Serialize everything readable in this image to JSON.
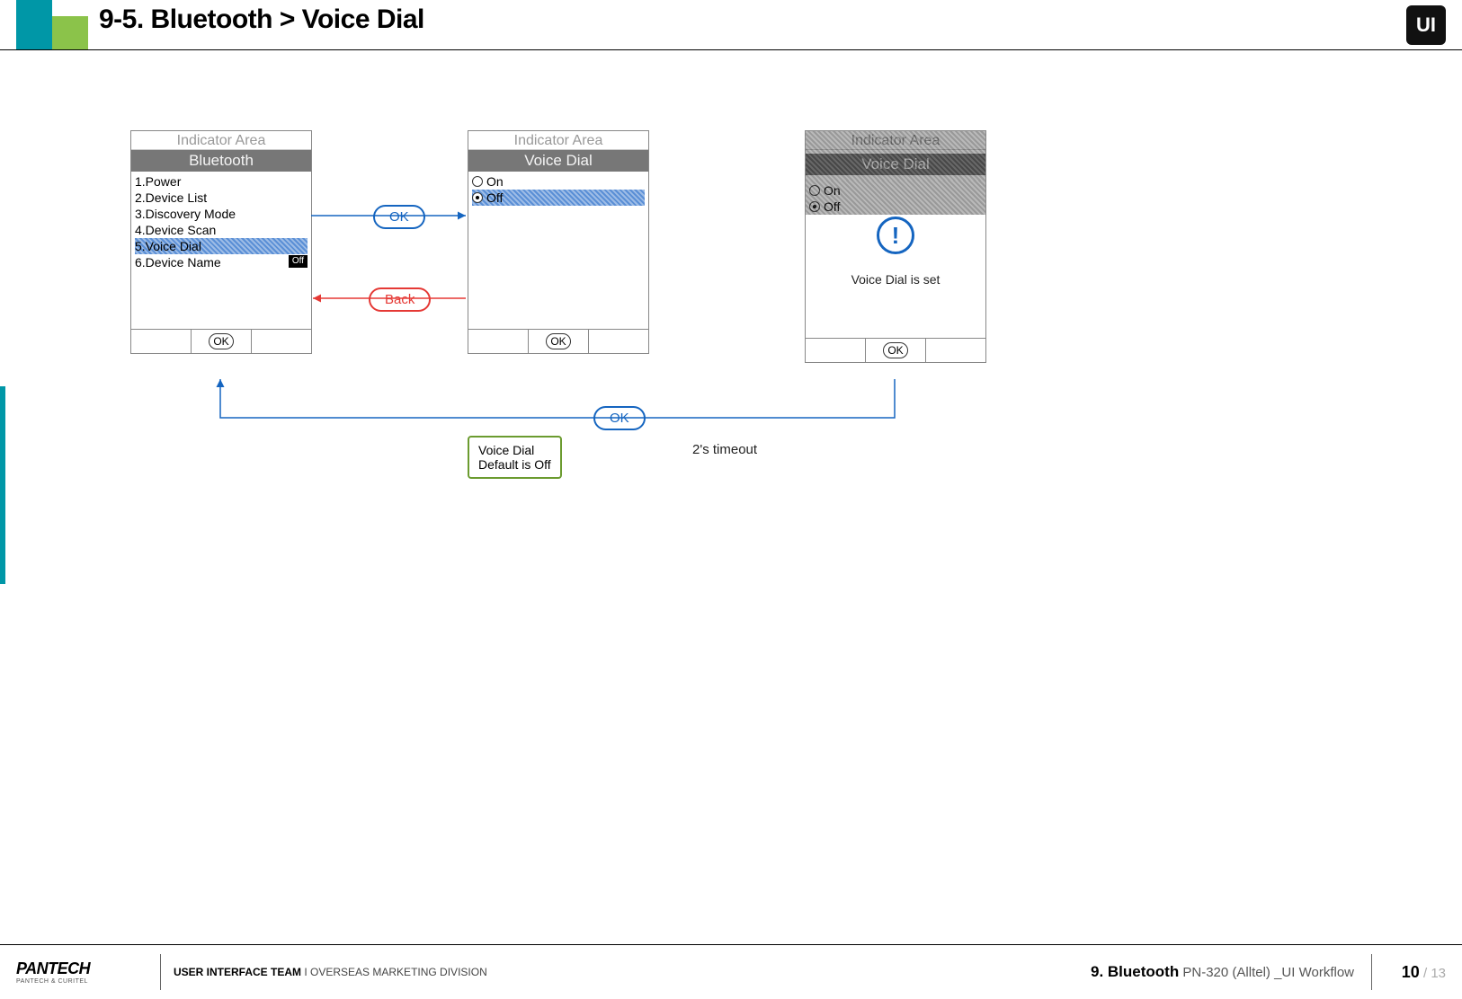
{
  "header": {
    "title": "9-5. Bluetooth > Voice Dial",
    "logo": "UI"
  },
  "phone1": {
    "indicator": "Indicator Area",
    "title": "Bluetooth",
    "items": [
      "1.Power",
      "2.Device List",
      "3.Discovery Mode",
      "4.Device Scan",
      "5.Voice Dial",
      "6.Device Name"
    ],
    "selected_index": 4,
    "badge_on_index": 5,
    "badge_text": "Off",
    "softkey_center": "OK"
  },
  "phone2": {
    "indicator": "Indicator Area",
    "title": "Voice Dial",
    "options": [
      "On",
      "Off"
    ],
    "selected_index": 1,
    "softkey_center": "OK"
  },
  "phone3": {
    "indicator": "Indicator Area",
    "title": "Voice Dial",
    "bg_options": [
      "On",
      "Off"
    ],
    "popup_msg": "Voice Dial is set",
    "softkey_center": "OK"
  },
  "flow": {
    "ok_label": "OK",
    "back_label": "Back",
    "ok2_label": "OK",
    "timeout": "2's timeout"
  },
  "note": {
    "line1": "Voice Dial",
    "line2": "Default is Off"
  },
  "footer": {
    "brand_main": "PANTECH",
    "brand_sub": "PANTECH & CURITEL",
    "team_bold": "USER INTERFACE TEAM",
    "team_sep": "  I  ",
    "team_div": "OVERSEAS MARKETING DIVISION",
    "chapter_bold": "9. Bluetooth",
    "chapter_rest": " PN-320 (Alltel) _UI Workflow",
    "page_current": "10",
    "page_total": " / 13"
  }
}
